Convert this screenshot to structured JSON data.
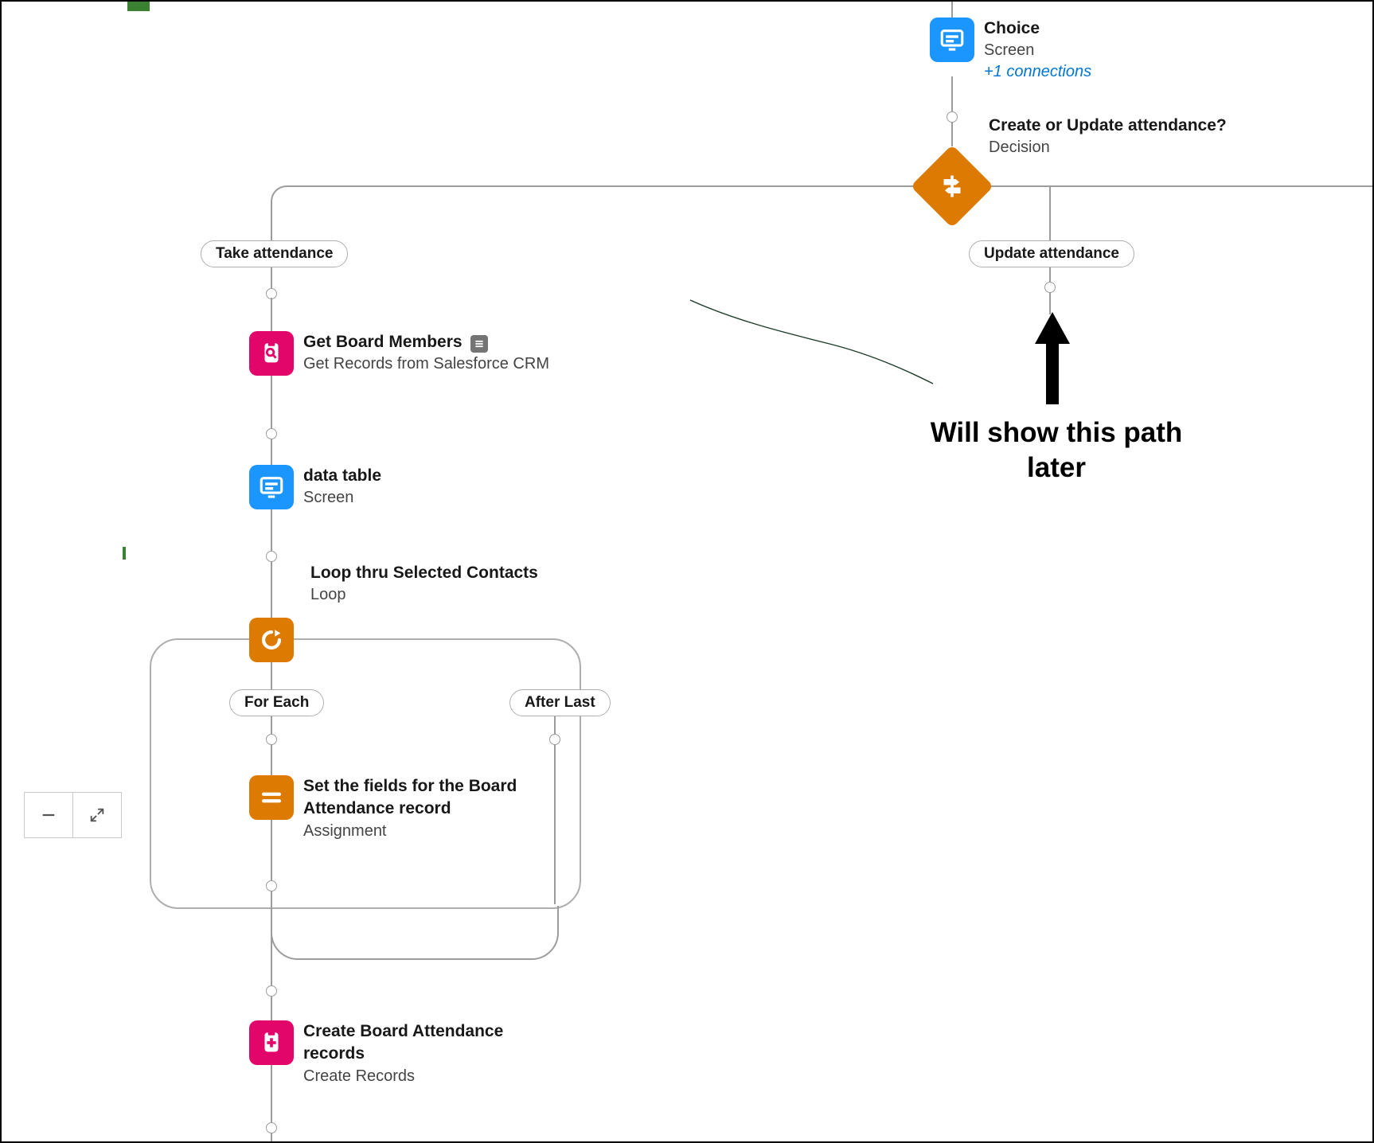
{
  "nodes": {
    "choice": {
      "title": "Choice",
      "sub": "Screen",
      "link": "+1 connections"
    },
    "decision": {
      "title": "Create or Update attendance?",
      "sub": "Decision"
    },
    "getBoard": {
      "title": "Get Board Members",
      "sub": "Get Records from Salesforce CRM"
    },
    "dataTable": {
      "title": "data table",
      "sub": "Screen"
    },
    "loop": {
      "title": "Loop thru Selected Contacts",
      "sub": "Loop"
    },
    "assign": {
      "title": "Set the fields for the Board Attendance record",
      "sub": "Assignment"
    },
    "create": {
      "title": "Create Board Attendance records",
      "sub": "Create Records"
    }
  },
  "pills": {
    "take": "Take attendance",
    "update": "Update attendance",
    "forEach": "For Each",
    "afterLast": "After Last"
  },
  "annotation": "Will show this path later",
  "zoom": {
    "out": "−",
    "expand": "⤢"
  }
}
